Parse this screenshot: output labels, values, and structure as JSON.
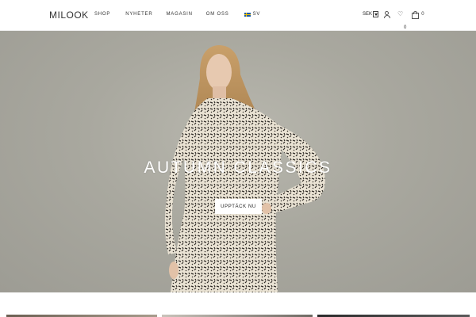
{
  "brand": {
    "logo_text": "MILOOK"
  },
  "nav": {
    "items": [
      {
        "label": "SHOP"
      },
      {
        "label": "NYHETER"
      },
      {
        "label": "MAGASIN"
      },
      {
        "label": "OM OSS"
      }
    ],
    "language": {
      "label": "SV",
      "flag_icon": "sweden-flag-icon"
    }
  },
  "tools": {
    "currency": {
      "selected": "SEK"
    },
    "account_icon": "user-icon",
    "wishlist_icon": "heart-icon",
    "wishlist_count": "0",
    "cart_icon": "shopping-bag-icon",
    "cart_count": "0"
  },
  "hero": {
    "title": "AUTUMN CLASSICS",
    "cta_label": "UPPTÄCK NU"
  },
  "colors": {
    "hero_background": "#aaa99f",
    "cta_background": "#ffffff",
    "text_primary": "#222222"
  }
}
